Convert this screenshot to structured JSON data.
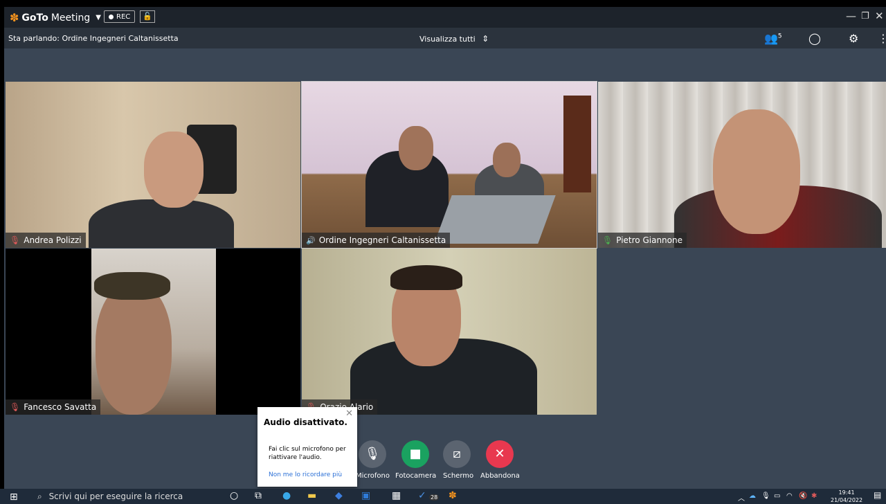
{
  "app": {
    "brand_bold": "GoTo",
    "brand_rest": "Meeting",
    "rec_label": "REC"
  },
  "infobar": {
    "speaking": "Sta parlando: Ordine Ingegneri Caltanissetta",
    "view_all": "Visualizza tutti",
    "participants_count": "5"
  },
  "tiles": [
    {
      "name": "Andrea Polizzi",
      "mic": "off"
    },
    {
      "name": "Ordine Ingegneri Caltanissetta",
      "mic": "speaking"
    },
    {
      "name": "Pietro Giannone",
      "mic": "on"
    },
    {
      "name": "Fancesco Savatta",
      "mic": "off"
    },
    {
      "name": "Orazio Alario",
      "mic": "off"
    }
  ],
  "controls": {
    "microphone": "Microfono",
    "camera": "Fotocamera",
    "screen": "Schermo",
    "leave": "Abbandona"
  },
  "popup": {
    "title": "Audio disattivato.",
    "body": "Fai clic sul microfono per riattivare l'audio.",
    "link": "Non me lo ricordare più"
  },
  "taskbar": {
    "search_placeholder": "Scrivi qui per eseguire la ricerca",
    "badge": "28",
    "time": "19:41",
    "date": "21/04/2022"
  },
  "colors": {
    "titlebar": "#1d232b",
    "background": "#3a4655",
    "camera_green": "#1aa260",
    "leave_red": "#e8384f",
    "brand_orange": "#f7941d"
  }
}
